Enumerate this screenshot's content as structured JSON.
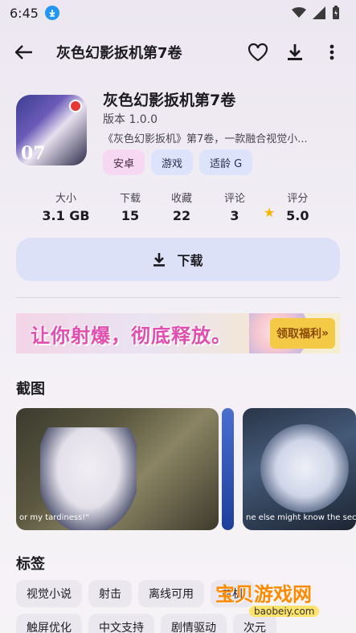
{
  "status_bar": {
    "time": "6:45"
  },
  "topbar": {
    "title": "灰色幻影扳机第7卷"
  },
  "app": {
    "name": "灰色幻影扳机第7卷",
    "version": "版本 1.0.0",
    "description": "《灰色幻影扳机》第7卷，一款融合视觉小...",
    "icon_number": "07",
    "chips": [
      "安卓",
      "游戏",
      "适龄 G"
    ]
  },
  "stats": [
    {
      "label": "大小",
      "value": "3.1 GB"
    },
    {
      "label": "下载",
      "value": "15"
    },
    {
      "label": "收藏",
      "value": "22"
    },
    {
      "label": "评论",
      "value": "3"
    },
    {
      "label": "评分",
      "value": "5.0"
    }
  ],
  "download_label": "下载",
  "banner": {
    "text": "让你射爆，彻底释放。",
    "badge": "领取福利"
  },
  "screenshots_title": "截图",
  "screenshots": [
    {
      "caption": "or my tardiness!\""
    },
    {
      "caption": ""
    },
    {
      "caption": "ne else might know the security"
    }
  ],
  "tags_title": "标签",
  "tags": [
    [
      "视觉小说",
      "射击",
      "离线可用",
      "单机"
    ],
    [
      "触屏优化",
      "中文支持",
      "剧情驱动",
      "次元"
    ]
  ],
  "watermark": {
    "text": "宝贝游戏网",
    "sub": "baobeiy.com"
  },
  "colors": {
    "accent": "#dde1f7",
    "chip_pink": "#f7d8f2",
    "chip_blue": "#dce3fb",
    "star": "#f5b400"
  }
}
